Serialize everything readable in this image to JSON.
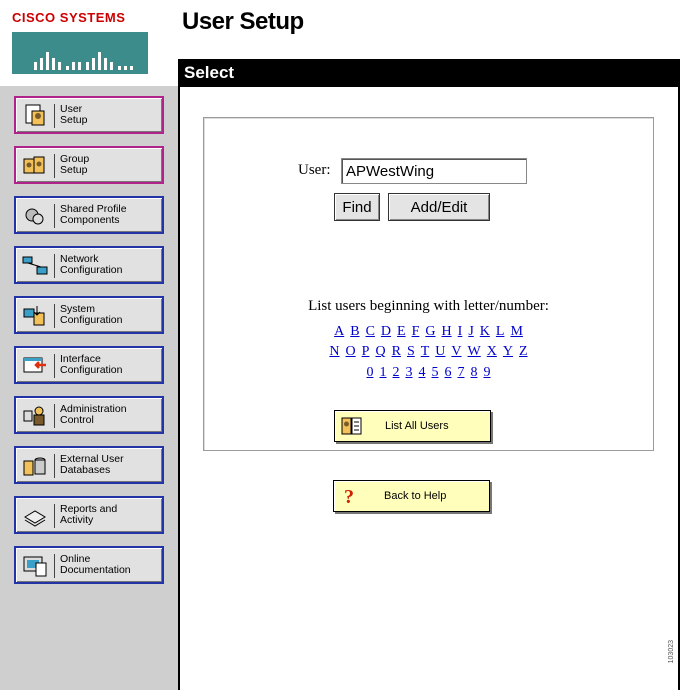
{
  "logo": {
    "text": "CISCO SYSTEMS",
    "brand_color": "#cc0000",
    "bar_color": "#3c8c8c"
  },
  "page_title": "User Setup",
  "section": {
    "title": "Select"
  },
  "sidebar": {
    "items": [
      {
        "label": "User\nSetup",
        "icon": "user-setup-icon"
      },
      {
        "label": "Group\nSetup",
        "icon": "group-setup-icon"
      },
      {
        "label": "Shared Profile\nComponents",
        "icon": "shared-profile-icon"
      },
      {
        "label": "Network\nConfiguration",
        "icon": "network-config-icon"
      },
      {
        "label": "System\nConfiguration",
        "icon": "system-config-icon"
      },
      {
        "label": "Interface\nConfiguration",
        "icon": "interface-config-icon"
      },
      {
        "label": "Administration\nControl",
        "icon": "admin-control-icon"
      },
      {
        "label": "External User\nDatabases",
        "icon": "external-db-icon"
      },
      {
        "label": "Reports and\nActivity",
        "icon": "reports-icon"
      },
      {
        "label": "Online\nDocumentation",
        "icon": "online-doc-icon"
      }
    ]
  },
  "form": {
    "user_label": "User:",
    "user_value": "APWestWing",
    "find_label": "Find",
    "add_edit_label": "Add/Edit"
  },
  "list": {
    "heading": "List users beginning with letter/number:",
    "row1": [
      "A",
      "B",
      "C",
      "D",
      "E",
      "F",
      "G",
      "H",
      "I",
      "J",
      "K",
      "L",
      "M"
    ],
    "row2": [
      "N",
      "O",
      "P",
      "Q",
      "R",
      "S",
      "T",
      "U",
      "V",
      "W",
      "X",
      "Y",
      "Z"
    ],
    "row3": [
      "0",
      "1",
      "2",
      "3",
      "4",
      "5",
      "6",
      "7",
      "8",
      "9"
    ]
  },
  "buttons": {
    "list_all_label": "List All Users",
    "back_help_label": "Back to Help"
  },
  "side_code": "103023"
}
